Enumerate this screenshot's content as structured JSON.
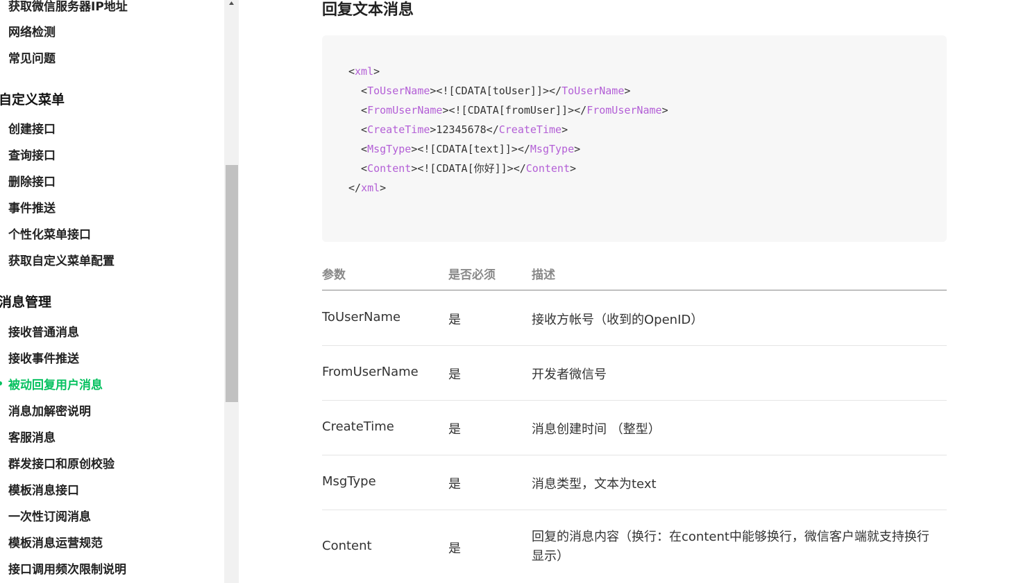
{
  "sidebar": {
    "items_top": [
      "获取微信服务器IP地址",
      "网络检测",
      "常见问题"
    ],
    "group_menu": "自定义菜单",
    "items_menu": [
      "创建接口",
      "查询接口",
      "删除接口",
      "事件推送",
      "个性化菜单接口",
      "获取自定义菜单配置"
    ],
    "group_msg": "消息管理",
    "items_msg": [
      "接收普通消息",
      "接收事件推送",
      "被动回复用户消息",
      "消息加解密说明",
      "客服消息",
      "群发接口和原创校验",
      "模板消息接口",
      "一次性订阅消息",
      "模板消息运营规范",
      "接口调用频次限制说明"
    ],
    "active_color": "#07c160"
  },
  "main": {
    "title": "回复文本消息",
    "code": {
      "l1": [
        "<",
        "xml",
        ">"
      ],
      "l2": [
        "  <",
        "ToUserName",
        "><![CDATA[toUser]]></",
        "ToUserName",
        ">"
      ],
      "l3": [
        "  <",
        "FromUserName",
        "><![CDATA[fromUser]]></",
        "FromUserName",
        ">"
      ],
      "l4": [
        "  <",
        "CreateTime",
        ">12345678</",
        "CreateTime",
        ">"
      ],
      "l5": [
        "  <",
        "MsgType",
        "><![CDATA[text]]></",
        "MsgType",
        ">"
      ],
      "l6": [
        "  <",
        "Content",
        "><![CDATA[你好]]></",
        "Content",
        ">"
      ],
      "l7": [
        "</",
        "xml",
        ">"
      ]
    },
    "table": {
      "headers": [
        "参数",
        "是否必须",
        "描述"
      ],
      "rows": [
        [
          "ToUserName",
          "是",
          "接收方帐号（收到的OpenID）"
        ],
        [
          "FromUserName",
          "是",
          "开发者微信号"
        ],
        [
          "CreateTime",
          "是",
          "消息创建时间 （整型）"
        ],
        [
          "MsgType",
          "是",
          "消息类型，文本为text"
        ],
        [
          "Content",
          "是",
          "回复的消息内容（换行：在content中能够换行，微信客户端就支持换行显示）"
        ]
      ]
    }
  }
}
